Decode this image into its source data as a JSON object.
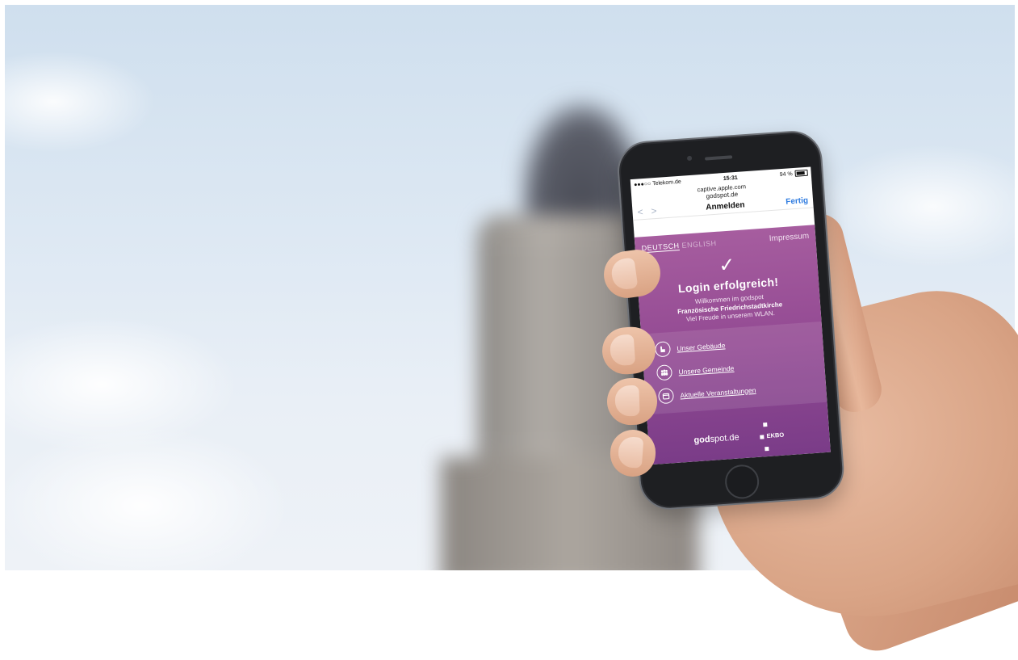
{
  "phone": {
    "status": {
      "carrier": "●●●○○ Telekom.de",
      "time": "15:31",
      "battery": "94 %"
    },
    "url_line1": "captive.apple.com",
    "url_line2": "godspot.de",
    "nav": {
      "back": "<",
      "forward": ">",
      "title": "Anmelden",
      "done": "Fertig"
    },
    "lang": {
      "active": "DEUTSCH",
      "inactive": "ENGLISH",
      "impressum": "Impressum"
    },
    "check": "✓",
    "headline": "Login erfolgreich!",
    "welcome_line1": "Willkommen im godspot",
    "welcome_line2": "Französische Friedrichstadtkirche",
    "welcome_line3": "Viel Freude in unserem WLAN.",
    "links": [
      {
        "icon": "building-icon",
        "label": "Unser Gebäude"
      },
      {
        "icon": "people-icon",
        "label": "Unsere Gemeinde"
      },
      {
        "icon": "calendar-icon",
        "label": "Aktuelle Veranstaltungen"
      }
    ],
    "footer": {
      "brand_bold": "god",
      "brand_rest": "spot.de",
      "partner": "EKBO"
    }
  },
  "colors": {
    "accent_purple": "#934a93",
    "ios_blue": "#2f7ce0"
  }
}
